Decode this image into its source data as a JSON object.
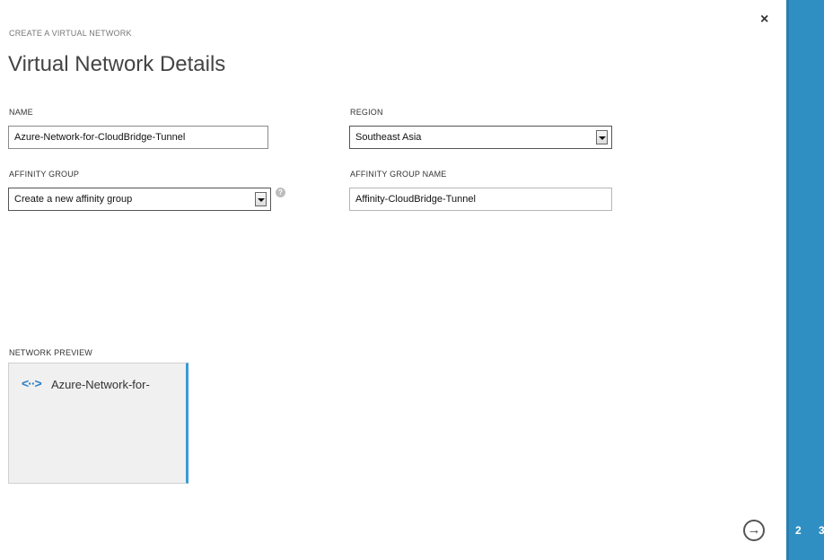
{
  "wizard": {
    "label": "CREATE A VIRTUAL NETWORK",
    "title": "Virtual Network Details"
  },
  "form": {
    "name": {
      "label": "NAME",
      "value": "Azure-Network-for-CloudBridge-Tunnel"
    },
    "region": {
      "label": "REGION",
      "selected": "Southeast Asia"
    },
    "affinity_group": {
      "label": "AFFINITY GROUP",
      "selected": "Create a new affinity group",
      "help_icon": "question-icon"
    },
    "affinity_group_name": {
      "label": "AFFINITY GROUP NAME",
      "value": "Affinity-CloudBridge-Tunnel"
    }
  },
  "preview": {
    "label": "NETWORK PREVIEW",
    "icon": "<··>",
    "network_name": "Azure-Network-for-"
  },
  "controls": {
    "close": "×",
    "next": "→"
  },
  "steps": [
    "2",
    "3"
  ],
  "colors": {
    "accent": "#2f8fc3",
    "icon_blue": "#2d7fc4"
  }
}
